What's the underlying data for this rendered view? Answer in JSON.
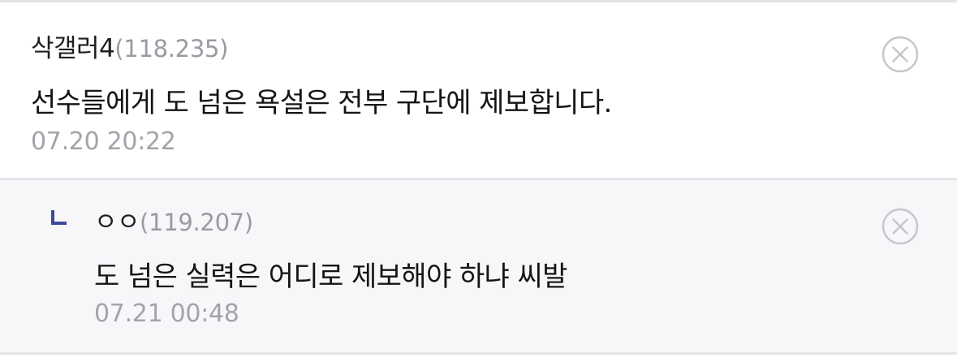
{
  "comments": [
    {
      "nickname": "삭갤러4",
      "ip": "(118.235)",
      "text": "선수들에게 도 넘은 욕설은 전부 구단에 제보합니다.",
      "time": "07.20 20:22",
      "delete_icon": "circle-x-icon"
    }
  ],
  "replies": [
    {
      "reply_marker": "reply-arrow-icon",
      "nickname": "ㅇㅇ",
      "ip": "(119.207)",
      "text": "도 넘은 실력은 어디로 제보해야 하냐 씨발",
      "time": "07.21 00:48",
      "delete_icon": "circle-x-icon"
    }
  ],
  "colors": {
    "divider": "#e3e3e8",
    "reply_background": "#f7f7fa",
    "reply_marker": "#3b4a9c",
    "meta_text": "#a3a3ab",
    "body_text": "#151515"
  }
}
